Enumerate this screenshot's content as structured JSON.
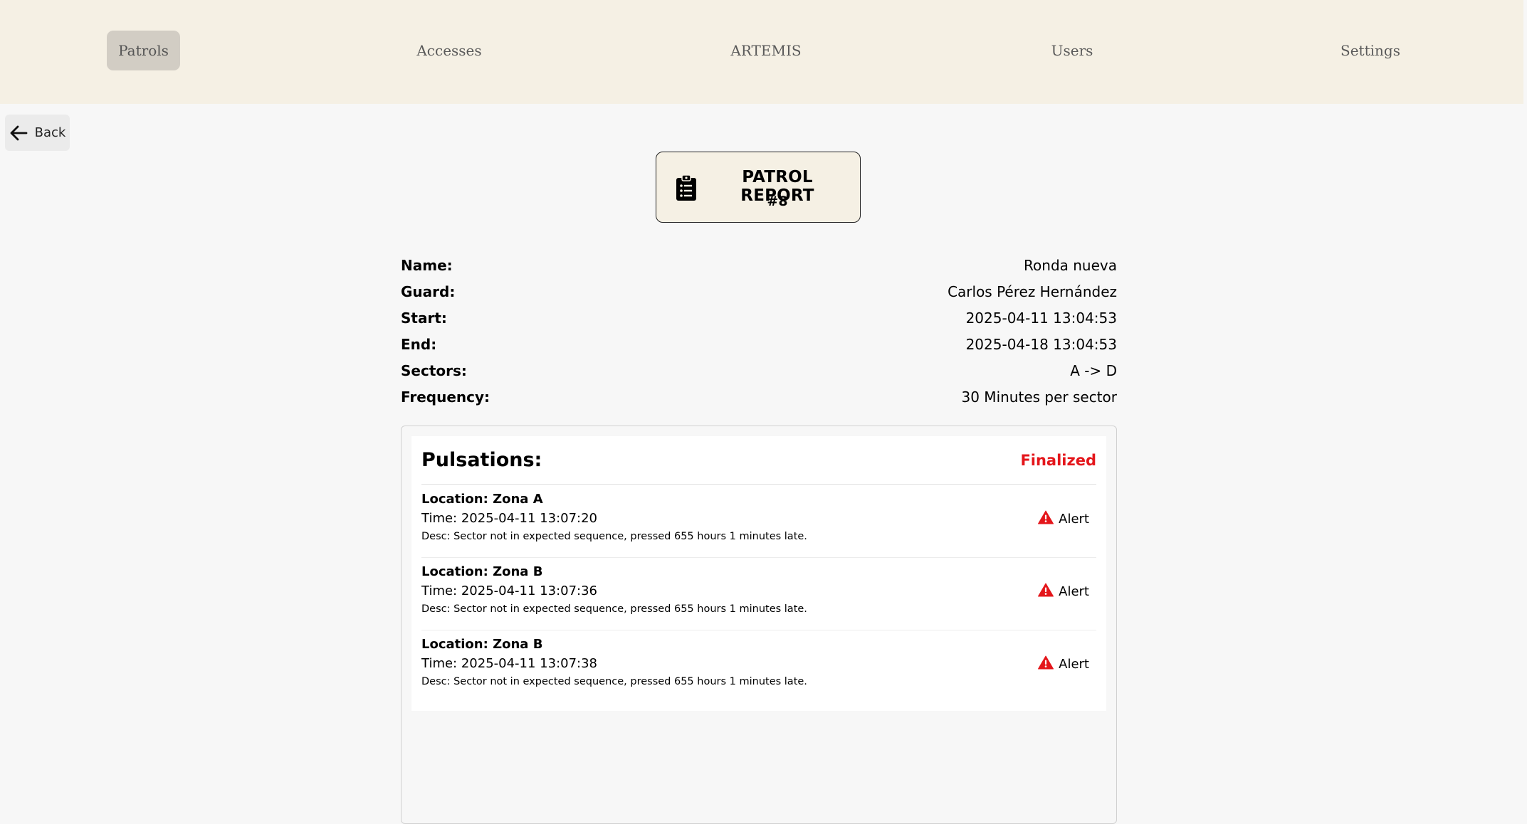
{
  "nav": {
    "items": [
      {
        "label": "Patrols",
        "active": true
      },
      {
        "label": "Accesses",
        "active": false
      },
      {
        "label": "ARTEMIS",
        "active": false
      },
      {
        "label": "Users",
        "active": false
      },
      {
        "label": "Settings",
        "active": false
      }
    ]
  },
  "back": {
    "label": "Back",
    "icon": "arrow-left-icon"
  },
  "report": {
    "title": "PATROL REPORT",
    "number": "#8",
    "icon": "clipboard-list-icon"
  },
  "details": [
    {
      "label": "Name:",
      "value": "Ronda nueva"
    },
    {
      "label": "Guard:",
      "value": "Carlos Pérez Hernández"
    },
    {
      "label": "Start:",
      "value": "2025-04-11 13:04:53"
    },
    {
      "label": "End:",
      "value": "2025-04-18 13:04:53"
    },
    {
      "label": "Sectors:",
      "value": "A -> D"
    },
    {
      "label": "Frequency:",
      "value": "30 Minutes per sector"
    }
  ],
  "pulsations": {
    "title": "Pulsations:",
    "status": "Finalized",
    "status_color": "#e4161b",
    "items": [
      {
        "location": "Location: Zona A",
        "time": "Time: 2025-04-11 13:07:20",
        "desc": "Desc: Sector not in expected sequence, pressed 655 hours 1 minutes late.",
        "badge": "Alert",
        "badge_icon": "warning-triangle-icon"
      },
      {
        "location": "Location: Zona B",
        "time": "Time: 2025-04-11 13:07:36",
        "desc": "Desc: Sector not in expected sequence, pressed 655 hours 1 minutes late.",
        "badge": "Alert",
        "badge_icon": "warning-triangle-icon"
      },
      {
        "location": "Location: Zona B",
        "time": "Time: 2025-04-11 13:07:38",
        "desc": "Desc: Sector not in expected sequence, pressed 655 hours 1 minutes late.",
        "badge": "Alert",
        "badge_icon": "warning-triangle-icon"
      }
    ]
  },
  "colors": {
    "nav_bg": "#f5f0e4",
    "nav_active_bg": "#d2cdc4",
    "page_bg": "#f7f7f7",
    "alert_red": "#e4161b"
  }
}
